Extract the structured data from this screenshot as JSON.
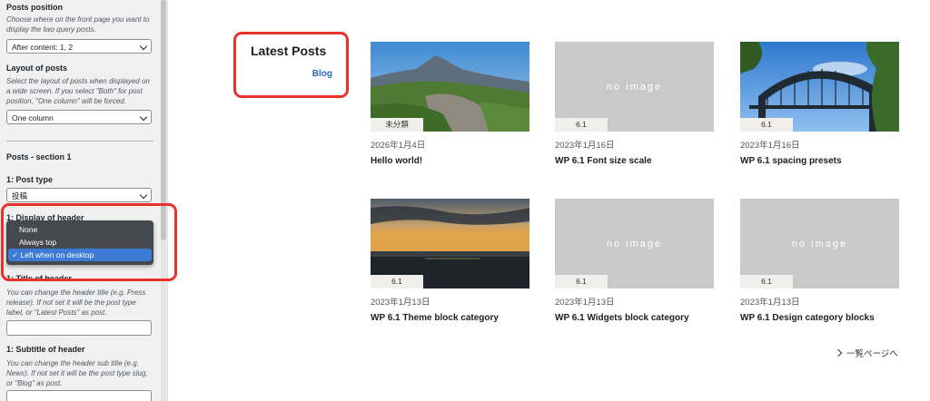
{
  "sidebar": {
    "posts_position": {
      "label": "Posts position",
      "description": "Choose where on the front page you want to display the two query posts.",
      "value": "After content: 1, 2"
    },
    "layout_of_posts": {
      "label": "Layout of posts",
      "description": "Select the layout of posts when displayed on a wide screen. If you select \"Both\" for post position, \"One column\" will be forced.",
      "value": "One column"
    },
    "section_title": "Posts - section 1",
    "post_type": {
      "label": "1: Post type",
      "value": "投稿"
    },
    "display_of_header": {
      "label": "1: Display of header",
      "options": [
        "None",
        "Always top",
        "Left when on desktop"
      ],
      "selected": "Left when on desktop",
      "check_mark": "✓"
    },
    "title_of_header": {
      "label": "1: Title of header",
      "description": "You can change the header title (e.g. Press release). If not set it will be the post type label, or \"Latest Posts\" as post.",
      "value": ""
    },
    "subtitle_of_header": {
      "label": "1: Subtitle of header",
      "description": "You can change the header sub title (e.g. News). If not set it will be the post type slug, or \"Blog\" as post.",
      "value": ""
    }
  },
  "main": {
    "header_title": "Latest Posts",
    "header_subtitle": "Blog",
    "no_image_text": "no image",
    "posts": [
      {
        "tag": "未分類",
        "date": "2026年1月4日",
        "title": "Hello world!",
        "image": "mountain-photo"
      },
      {
        "tag": "6.1",
        "date": "2023年1月16日",
        "title": "WP 6.1 Font size scale",
        "image": "none"
      },
      {
        "tag": "6.1",
        "date": "2023年1月16日",
        "title": "WP 6.1 spacing presets",
        "image": "bridge-photo"
      },
      {
        "tag": "6.1",
        "date": "2023年1月13日",
        "title": "WP 6.1 Theme block category",
        "image": "sunset-sea-photo"
      },
      {
        "tag": "6.1",
        "date": "2023年1月13日",
        "title": "WP 6.1 Widgets block category",
        "image": "none"
      },
      {
        "tag": "6.1",
        "date": "2023年1月13日",
        "title": "WP 6.1 Design category blocks",
        "image": "none"
      }
    ],
    "more_link": "一覧ページへ"
  },
  "colors": {
    "highlight_red": "#e8312a",
    "link_blue": "#2a6ab3",
    "dropdown_bg": "#45484d",
    "dropdown_active": "#3e7bd6",
    "placeholder_gray": "#c9c9c9"
  }
}
